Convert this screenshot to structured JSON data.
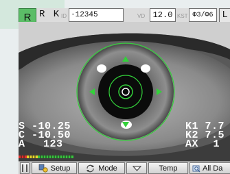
{
  "header": {
    "eye_button": "R",
    "mode_label": "R K",
    "patient_id_label": "ID",
    "patient_id": "·12345",
    "vd_label": "VD",
    "vd_value": "12.0",
    "kst_label": "KST",
    "pupil_value": "Φ3/Φ6",
    "left_eye_button": "L"
  },
  "readings": {
    "sphere_label": "S",
    "sphere_value": "-10.25",
    "cylinder_label": "C",
    "cylinder_value": "-10.50",
    "axis_label": "A",
    "axis_value": "123",
    "k1_label": "K1",
    "k1_value": "7.7",
    "k2_label": "K2",
    "k2_value": "7.5",
    "ax_label": "AX",
    "ax_value": "1"
  },
  "toolbar": {
    "setup_label": "Setup",
    "mode_label": "Mode",
    "temp_label": "Temp",
    "alldata_label": "All Da"
  },
  "colors": {
    "accent_green": "#3fbf4a",
    "reticle_green": "#33d13a",
    "eye_button_green": "#5bbd67",
    "signal_bar_red": "#e0302a",
    "signal_bar_yellow": "#e7d52b",
    "signal_bar_green": "#38c23e"
  },
  "icons": [
    "setup-icon",
    "mode-icon",
    "dropdown-arrow-icon",
    "all-data-icon",
    "list-view-icon"
  ]
}
